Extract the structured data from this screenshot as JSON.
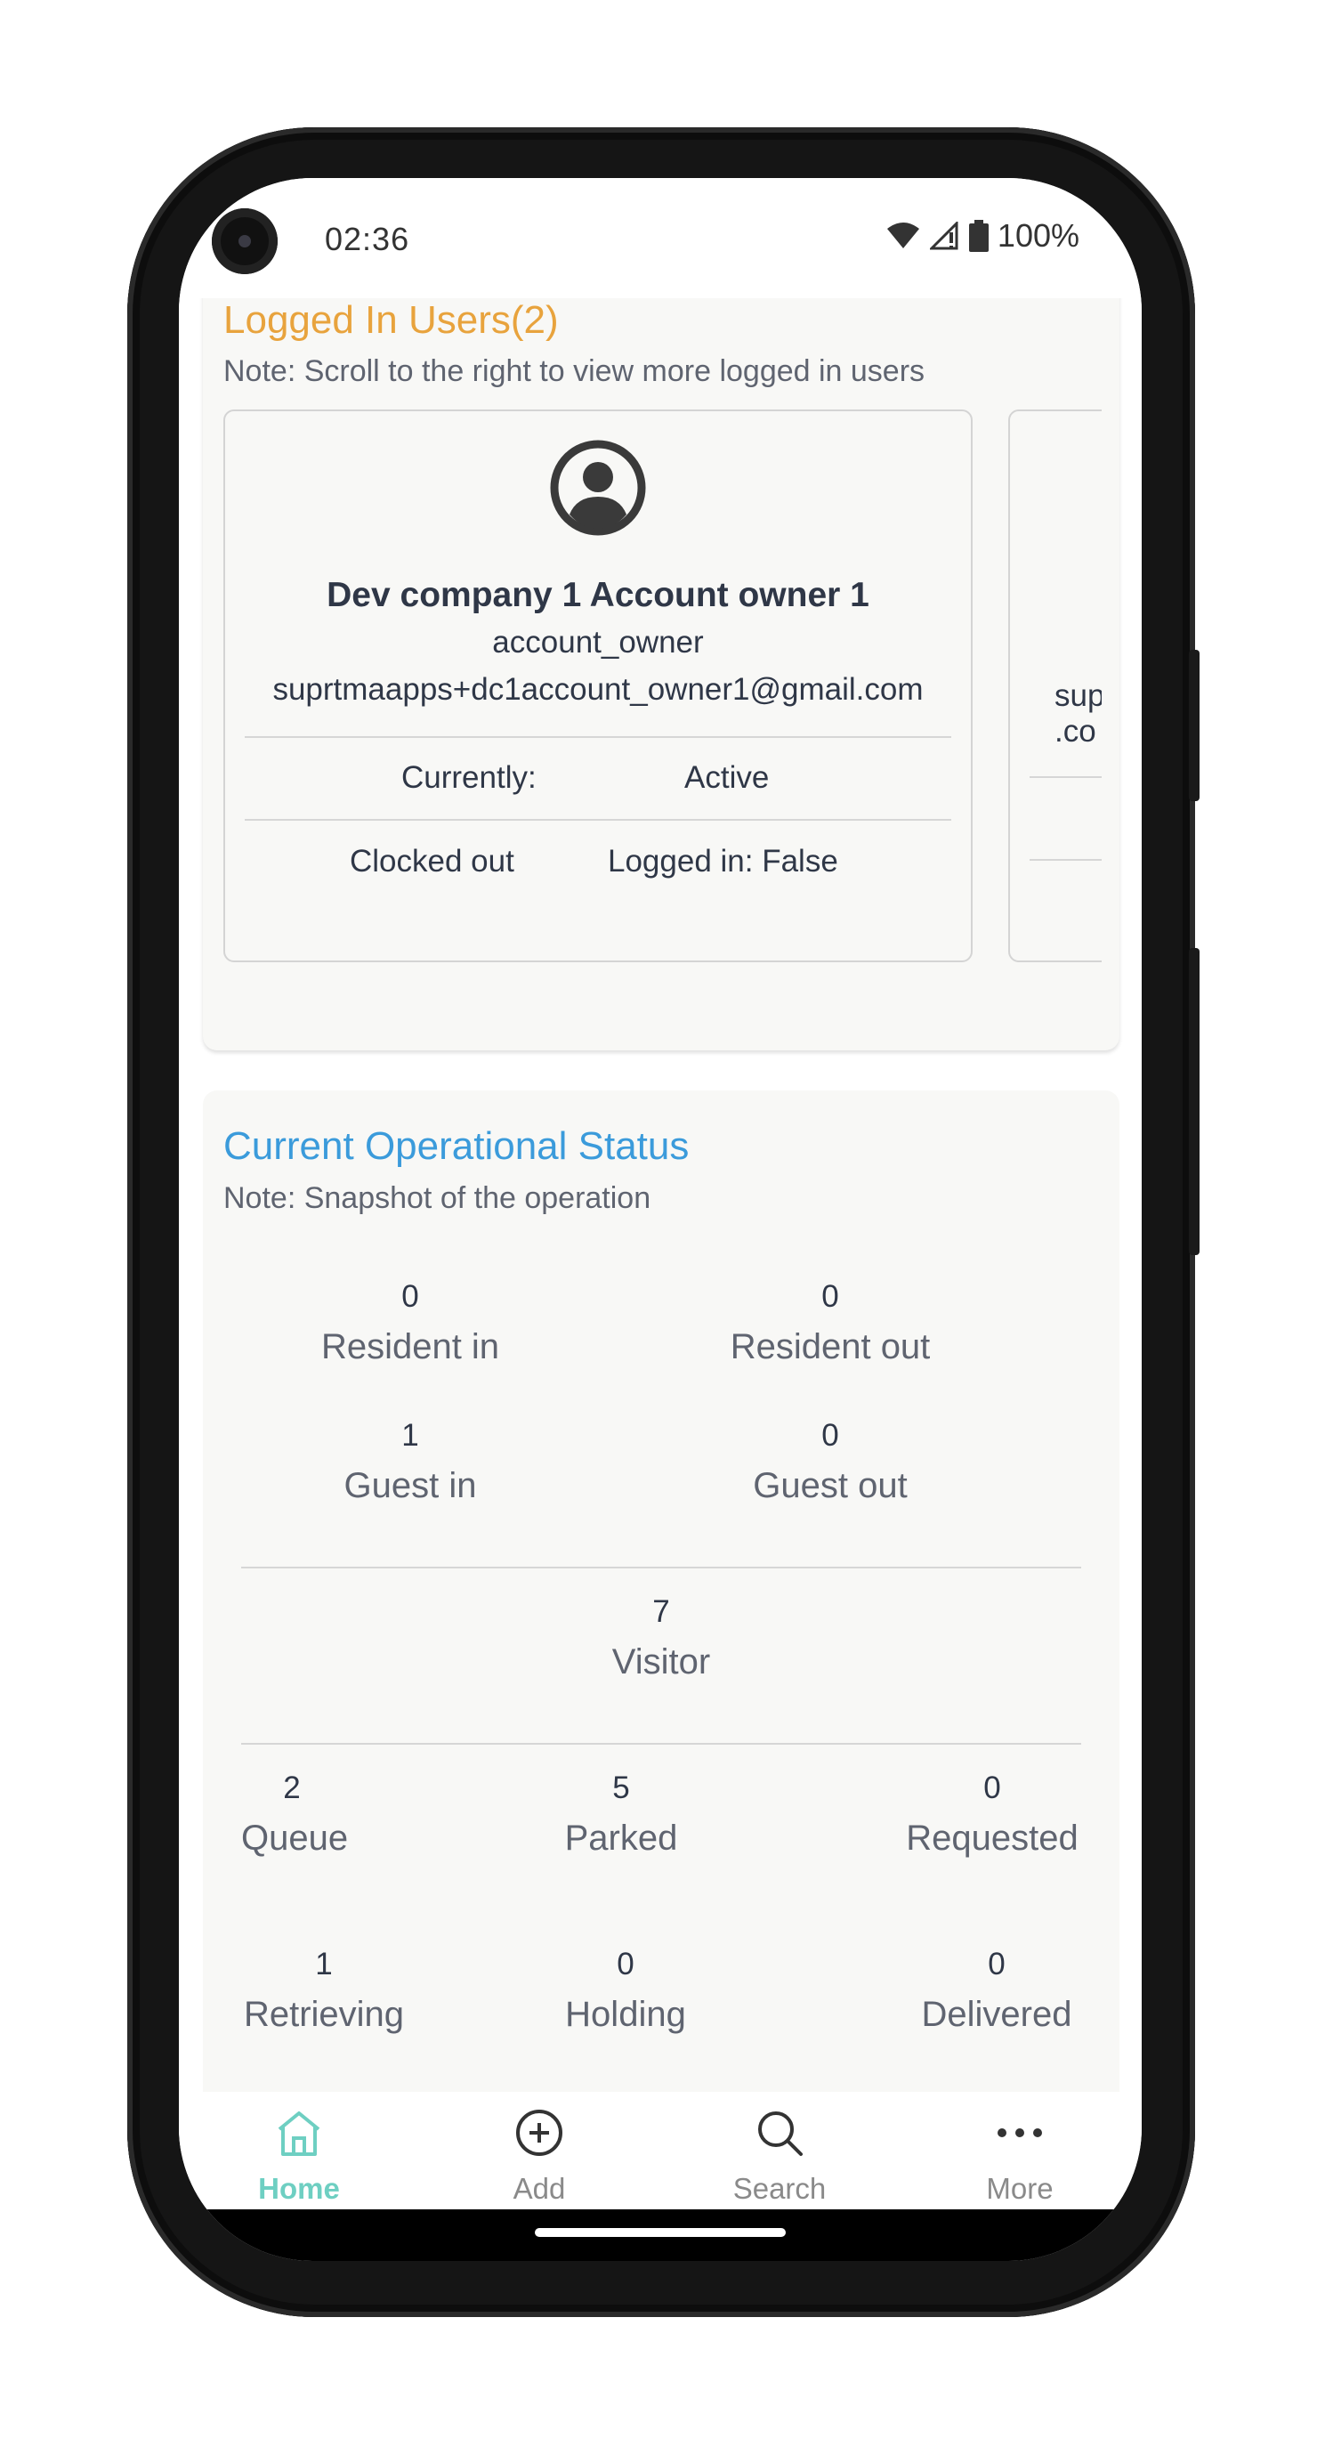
{
  "status_bar": {
    "time": "02:36",
    "battery": "100%"
  },
  "logged_in_users": {
    "title": "Logged In Users(2)",
    "note": "Note: Scroll to the right to view more logged in users",
    "users": [
      {
        "name": "Dev company 1 Account owner 1",
        "role": "account_owner",
        "email": "suprtmaapps+dc1account_owner1@gmail.com",
        "currently_label": "Currently:",
        "currently_value": "Active",
        "clock_status": "Clocked out",
        "logged_in": "Logged in: False"
      },
      {
        "email_partial_1": "sup",
        "email_partial_2": ".co"
      }
    ]
  },
  "operational_status": {
    "title": "Current Operational Status",
    "note": "Note: Snapshot of the operation",
    "resident_in": {
      "value": "0",
      "label": "Resident in"
    },
    "resident_out": {
      "value": "0",
      "label": "Resident out"
    },
    "guest_in": {
      "value": "1",
      "label": "Guest in"
    },
    "guest_out": {
      "value": "0",
      "label": "Guest out"
    },
    "visitor": {
      "value": "7",
      "label": "Visitor"
    },
    "queue": {
      "value": "2",
      "label": "Queue"
    },
    "parked": {
      "value": "5",
      "label": "Parked"
    },
    "requested": {
      "value": "0",
      "label": "Requested"
    },
    "retrieving": {
      "value": "1",
      "label": "Retrieving"
    },
    "holding": {
      "value": "0",
      "label": "Holding"
    },
    "delivered": {
      "value": "0",
      "label": "Delivered"
    }
  },
  "bottom_nav": {
    "home": "Home",
    "add": "Add",
    "search": "Search",
    "more": "More"
  },
  "colors": {
    "logged_in_title": "#e8a33d",
    "operational_title": "#3b9bdb",
    "nav_active": "#6ecfc2",
    "card_background": "#f8f8f6"
  },
  "icons": {
    "status": [
      "wifi-icon",
      "signal-icon",
      "battery-icon"
    ],
    "user_avatar": "account-circle-icon",
    "nav": [
      "home-icon",
      "add-circle-icon",
      "search-icon",
      "more-horizontal-icon"
    ]
  }
}
